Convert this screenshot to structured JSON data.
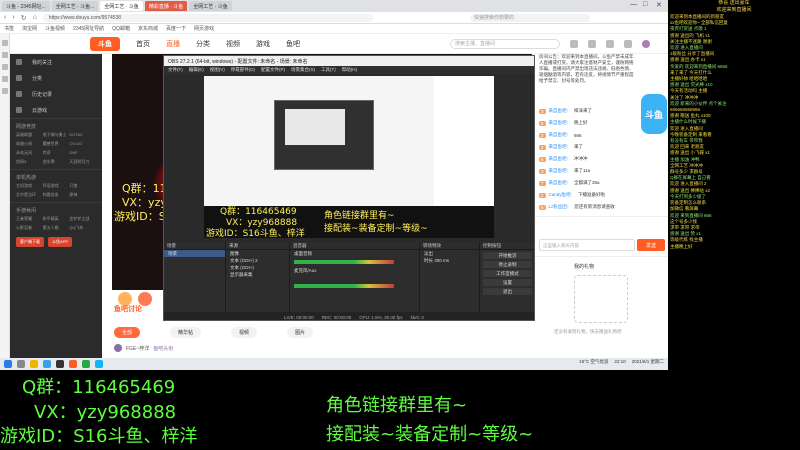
{
  "browser": {
    "tabs": [
      {
        "label": "斗鱼 - 2345网址...",
        "state": "normal"
      },
      {
        "label": "全网工艺 - 斗鱼...",
        "state": "normal"
      },
      {
        "label": "全网工艺 · 斗鱼",
        "state": "active"
      },
      {
        "label": "精彩直播 · 斗鱼",
        "state": "live"
      },
      {
        "label": "全网工艺 · 斗鱼",
        "state": "normal"
      }
    ],
    "url": "https://www.douyu.com/9574538",
    "search_placeholder": "快速搜索你想要的",
    "bookmarks": [
      "书签",
      "淘宝网",
      "斗鱼视频",
      "2345网址导航",
      "QQ邮箱",
      "京东商城",
      "百度一下",
      "网页游戏"
    ]
  },
  "site": {
    "logo": "斗鱼",
    "nav": [
      "首页",
      "直播",
      "分类",
      "视频",
      "游戏",
      "鱼吧"
    ],
    "active_nav": "直播",
    "search_placeholder": "搜索主播、直播间"
  },
  "sidebar": {
    "items": [
      "我的关注",
      "分类",
      "历史记录",
      "云游戏"
    ],
    "sections": [
      {
        "title": "网游竞技",
        "items": [
          "英雄联盟",
          "地下城与勇士",
          "DOTA2",
          "穿越火线",
          "魔兽世界",
          "CS:GO",
          "永劫无间",
          "传奇",
          "DNF",
          "剑网3",
          "逆水寒",
          "天涯明月刀"
        ]
      },
      {
        "title": "单机热游",
        "items": [
          "主机游戏",
          "怀旧游戏",
          "只狼",
          "艾尔登法环",
          "刺客信条",
          "原神"
        ]
      },
      {
        "title": "手游休闲",
        "items": [
          "王者荣耀",
          "和平精英",
          "金铲铲之战",
          "火影忍者",
          "第五人格",
          "QQ飞车"
        ]
      }
    ],
    "buttons": [
      "客户端下载",
      "斗鱼APP"
    ]
  },
  "video_overlay": {
    "lines": [
      "Q群：116465469",
      "VX：yzy968888",
      "游戏ID：S16斗鱼、梓洋"
    ],
    "right_lines": [
      "角色链接群里有~",
      "接配装~装备定制~等级~"
    ]
  },
  "under_video": {
    "section_title": "鱼吧讨论",
    "tabs": [
      "全部",
      "精华帖",
      "视频",
      "图片"
    ],
    "commenter": "FGE~梓洋",
    "comment_tag": "鱼吧头衔"
  },
  "chat": {
    "announcement": "房间公告：欢迎来到本直播间，斗鱼严禁未成年人直播或打赏。请大家注意财产安全，谨防网络诈骗。直播间内严禁出现违法违规、低俗色情、吸烟酗酒等内容，若有违反，将视情节严重程度给予禁言、封号等处罚。",
    "mascot": "斗鱼",
    "messages": [
      {
        "level": "3",
        "name": "来自鱼吧：",
        "text": "梓洋来了"
      },
      {
        "level": "5",
        "name": "来自鱼吧：",
        "text": "晚上好"
      },
      {
        "level": "2",
        "name": "来自鱼吧：",
        "text": "666"
      },
      {
        "level": "4",
        "name": "来自鱼吧：",
        "text": "来了"
      },
      {
        "level": "6",
        "name": "来自鱼吧：",
        "text": "冲冲冲"
      },
      {
        "level": "3",
        "name": "来自鱼吧：",
        "text": "来了11a"
      },
      {
        "level": "7",
        "name": "来自鱼吧：",
        "text": "全都满了35a"
      },
      {
        "level": "2",
        "name": "Candy鱼吧：",
        "text": "下播准备好啦"
      },
      {
        "level": "5",
        "name": "Lz粉丝团：",
        "text": "您还有新消息请查收"
      }
    ],
    "input_placeholder": "这里输入聊天内容",
    "send_label": "发送"
  },
  "right_panel": {
    "title": "我的礼物",
    "empty_text": "还没有收到礼物，快去赠送礼物吧"
  },
  "obs": {
    "title": "OBS 27.2.1 (64-bit, windows) - 配置文件: 未命名 - 场景: 未命名",
    "menu": [
      "文件(F)",
      "编辑(E)",
      "视图(V)",
      "停靠部件(D)",
      "配置文件(P)",
      "场景集合(S)",
      "工具(T)",
      "帮助(H)"
    ],
    "docks": {
      "scenes": {
        "title": "场景",
        "items": [
          "场景"
        ]
      },
      "sources": {
        "title": "来源",
        "items": [
          "图像",
          "文本 (GDI+) 2",
          "文本 (GDI+)",
          "显示器采集"
        ]
      },
      "mixer": {
        "title": "混音器",
        "items": [
          "桌面音频",
          "麦克风/Aux"
        ]
      },
      "transitions": {
        "title": "转场特效",
        "items": [
          "淡出",
          "时长 300 ms"
        ]
      },
      "controls": {
        "title": "控制按钮",
        "items": [
          "开始推流",
          "停止录制",
          "工作室模式",
          "设置",
          "退出"
        ]
      }
    },
    "status": [
      "LIVE: 00:00:00",
      "REC: 00:00:00",
      "CPU: 1.5%, 30.00 fps",
      "kb/s: 0"
    ]
  },
  "taskbar": {
    "tray": [
      "19°C 空气优良",
      "22:10",
      "2021/6/1 星期二"
    ]
  },
  "dark_chat": {
    "header": [
      "恭喜 送出豪车",
      "欢迎来到直播间"
    ],
    "lines": [
      "欢迎来到本直播间的新朋友",
      "xx鱼吧欢迎你~ 全部私信回复",
      "夜宵打赏送 点歌 1",
      "感谢 送出的 飞机 x1",
      "关注主播不迷路 谢谢",
      "欢迎 进入直播间",
      "1级粉丝 分享了直播间",
      "感谢 送出 办卡 x1",
      "亲爱的 欢迎来到直播间 6666",
      "来了来了 今天打什么",
      "主播好帅 哈哈哈哈",
      "感谢 送出 荧光棒 x10",
      "今天有活动吗 主播",
      "关注了 冲冲冲",
      "欢迎 新来的小伙伴 点个关注",
      "666666666666",
      "感谢 赠送 鱼丸 x100",
      "主播什么时候下播",
      "欢迎 进入直播间",
      "今晚装备定制 来看看",
      "有没有车 带带我",
      "欢迎 回来 老朋友",
      "感谢 送出 小飞碟 x1",
      "主播 加油 冲鸭",
      "全网工艺 冲冲冲",
      "群号多少 求群号",
      "Q群在屏幕上 自己看",
      "欢迎 进入直播间 2",
      "感谢 送出 棒棒哒 x2",
      "今天打到多少级了",
      "装备定制怎么联系",
      "加微信 看屏幕",
      "欢迎 来到直播间 666",
      "这个号多少钱",
      "求带 求带 求带",
      "感谢 送出 赞 x1",
      "等级代练 找主播",
      "主播晚上好"
    ]
  },
  "bottom_overlay": {
    "left_lines": [
      "Q群：116465469",
      "VX：yzy968888",
      "游戏ID：S16斗鱼、梓洋"
    ],
    "right_lines": [
      "角色链接群里有~",
      "接配装~装备定制~等级~"
    ]
  },
  "colors": {
    "brand": "#ff5d23",
    "overlay_green": "#5cff3c",
    "overlay_yellow": "#ffef5a",
    "obs_bg": "#2a2a2a"
  }
}
